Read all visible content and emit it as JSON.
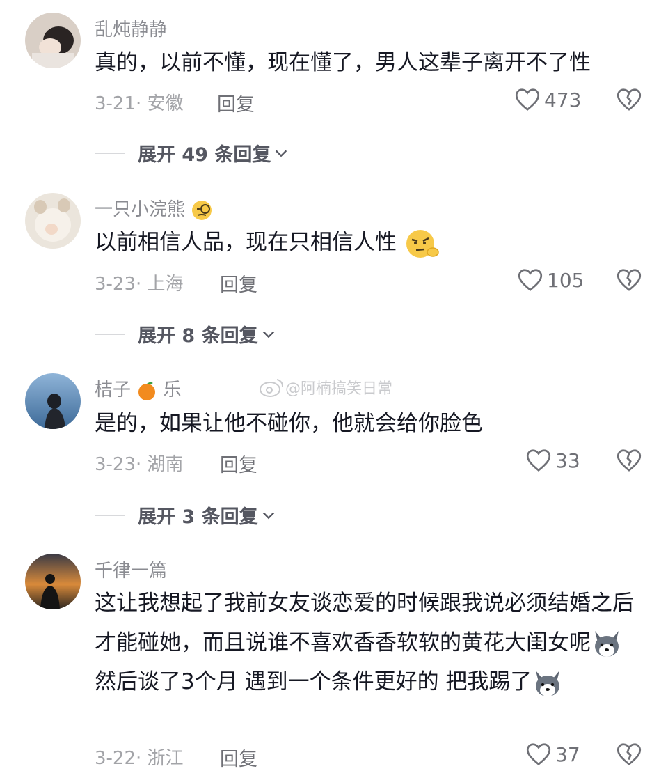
{
  "comments": [
    {
      "username": "乱炖静静",
      "text": "真的，以前不懂，现在懂了，男人这辈子离开不了性",
      "date_location": "3-21· 安徽",
      "reply_label": "回复",
      "likes": "473",
      "expand_label": "展开 49 条回复"
    },
    {
      "username": "一只小浣熊",
      "text": "以前相信人品，现在只相信人性",
      "date_location": "3-23· 上海",
      "reply_label": "回复",
      "likes": "105",
      "expand_label": "展开 8 条回复"
    },
    {
      "username_part1": "桔子",
      "username_part2": "乐",
      "text": "是的，如果让他不碰你，他就会给你脸色",
      "date_location": "3-23· 湖南",
      "reply_label": "回复",
      "likes": "33",
      "expand_label": "展开 3 条回复"
    },
    {
      "username": "千律一篇",
      "text_part1": "这让我想起了我前女友谈恋爱的时候跟我说必须结婚之后才能碰她，而且说谁不喜欢香香软软的黄花大闺女呢",
      "text_part2": " 然后谈了3个月 遇到一个条件更好的 把我踢了",
      "date_location": "3-22· 浙江",
      "reply_label": "回复",
      "likes": "37"
    }
  ],
  "watermark": "@阿楠搞笑日常",
  "colors": {
    "text": "#161823",
    "username": "#8a8b91",
    "meta": "#a3a4a8",
    "expand": "#555761"
  }
}
